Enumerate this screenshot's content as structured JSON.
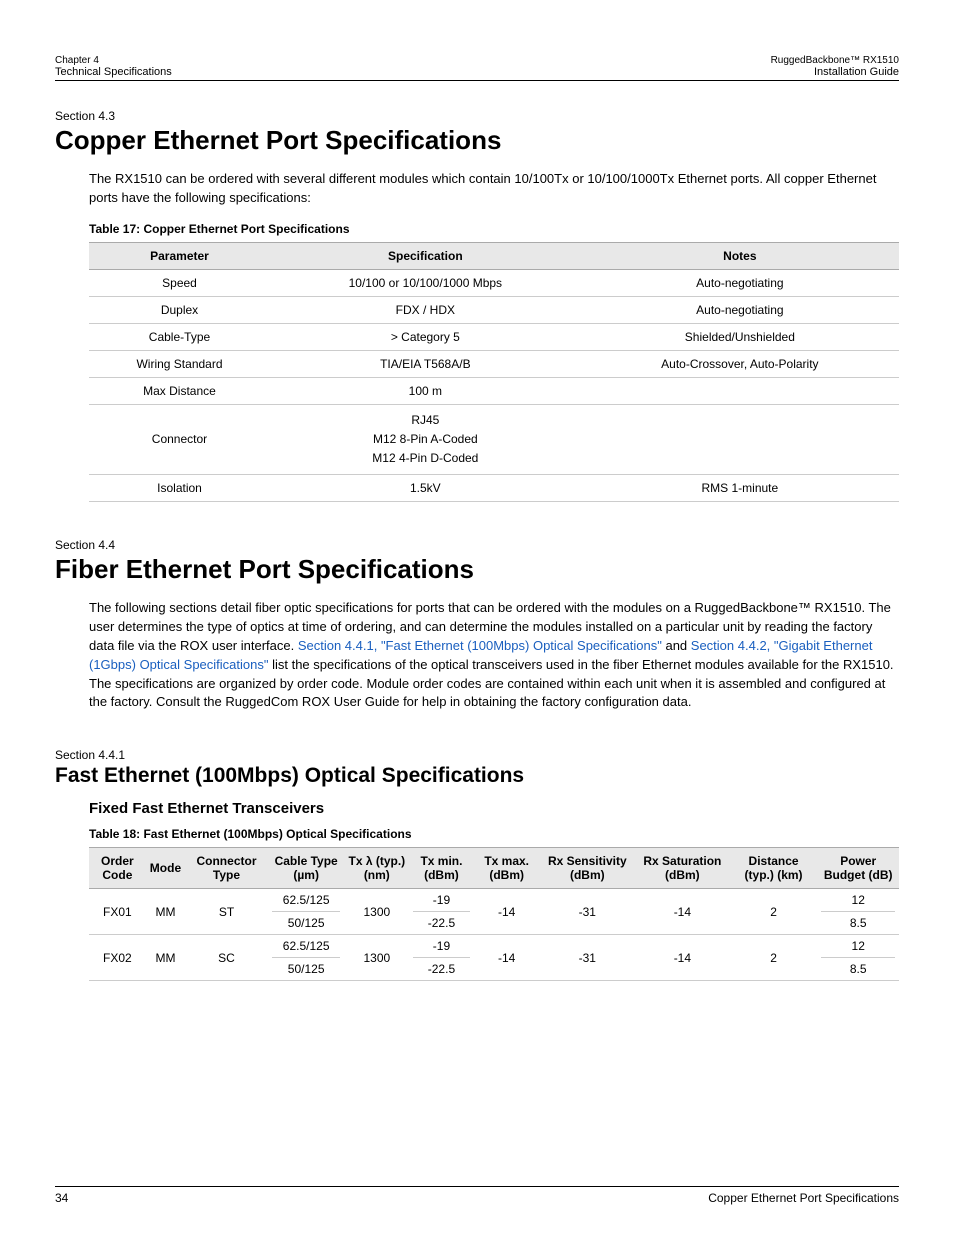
{
  "header": {
    "chapter": "Chapter 4",
    "left_sub": "Technical Specifications",
    "product": "RuggedBackbone™ RX1510",
    "right_sub": "Installation Guide"
  },
  "s43": {
    "label": "Section 4.3",
    "title": "Copper Ethernet Port Specifications",
    "intro": "The RX1510 can be ordered with several different modules which contain 10/100Tx or 10/100/1000Tx Ethernet ports. All copper Ethernet ports have the following specifications:",
    "table_caption": "Table 17: Copper Ethernet Port Specifications",
    "headers": {
      "c0": "Parameter",
      "c1": "Specification",
      "c2": "Notes"
    },
    "rows": [
      {
        "p": "Speed",
        "s": "10/100 or 10/100/1000 Mbps",
        "n": "Auto-negotiating"
      },
      {
        "p": "Duplex",
        "s": "FDX / HDX",
        "n": "Auto-negotiating"
      },
      {
        "p": "Cable-Type",
        "s": "> Category 5",
        "n": "Shielded/Unshielded"
      },
      {
        "p": "Wiring Standard",
        "s": "TIA/EIA T568A/B",
        "n": "Auto-Crossover, Auto-Polarity"
      },
      {
        "p": "Max Distance",
        "s": "100 m",
        "n": ""
      },
      {
        "p": "Connector",
        "s": "RJ45\nM12 8-Pin A-Coded\nM12 4-Pin D-Coded",
        "n": ""
      },
      {
        "p": "Isolation",
        "s": "1.5kV",
        "n": "RMS 1-minute"
      }
    ]
  },
  "s44": {
    "label": "Section 4.4",
    "title": "Fiber Ethernet Port Specifications",
    "intro_pre": "The following sections detail fiber optic specifications for ports that can be ordered with the modules on a RuggedBackbone™ RX1510. The user determines the type of optics at time of ordering, and can determine the modules installed on a particular unit by reading the factory data file via the ROX user interface. ",
    "link1": "Section 4.4.1, \"Fast Ethernet (100Mbps) Optical Specifications\"",
    "mid": " and ",
    "link2": "Section 4.4.2, \"Gigabit Ethernet (1Gbps) Optical Specifications\"",
    "intro_post": " list the specifications of the optical transceivers used in the fiber Ethernet modules available for the RX1510. The specifications are organized by order code. Module order codes are contained within each unit when it is assembled and configured at the factory. Consult the RuggedCom ROX User Guide for help in obtaining the factory configuration data."
  },
  "s441": {
    "label": "Section 4.4.1",
    "title": "Fast Ethernet (100Mbps) Optical Specifications",
    "subtitle": "Fixed Fast Ethernet Transceivers",
    "table_caption": "Table 18: Fast Ethernet (100Mbps) Optical Specifications",
    "headers": {
      "c0": "Order Code",
      "c1": "Mode",
      "c2": "Connector Type",
      "c3": "Cable Type (µm)",
      "c4": "Tx λ (typ.) (nm)",
      "c5": "Tx min. (dBm)",
      "c6": "Tx max. (dBm)",
      "c7": "Rx Sensitivity (dBm)",
      "c8": "Rx Saturation (dBm)",
      "c9": "Distance (typ.) (km)",
      "c10": "Power Budget (dB)"
    },
    "rows": [
      {
        "code": "FX01",
        "mode": "MM",
        "conn": "ST",
        "cable_a": "62.5/125",
        "cable_b": "50/125",
        "txl": "1300",
        "txmin_a": "-19",
        "txmin_b": "-22.5",
        "txmax": "-14",
        "rxsens": "-31",
        "rxsat": "-14",
        "dist": "2",
        "pb_a": "12",
        "pb_b": "8.5"
      },
      {
        "code": "FX02",
        "mode": "MM",
        "conn": "SC",
        "cable_a": "62.5/125",
        "cable_b": "50/125",
        "txl": "1300",
        "txmin_a": "-19",
        "txmin_b": "-22.5",
        "txmax": "-14",
        "rxsens": "-31",
        "rxsat": "-14",
        "dist": "2",
        "pb_a": "12",
        "pb_b": "8.5"
      }
    ]
  },
  "footer": {
    "page": "34",
    "right": "Copper Ethernet Port Specifications"
  }
}
